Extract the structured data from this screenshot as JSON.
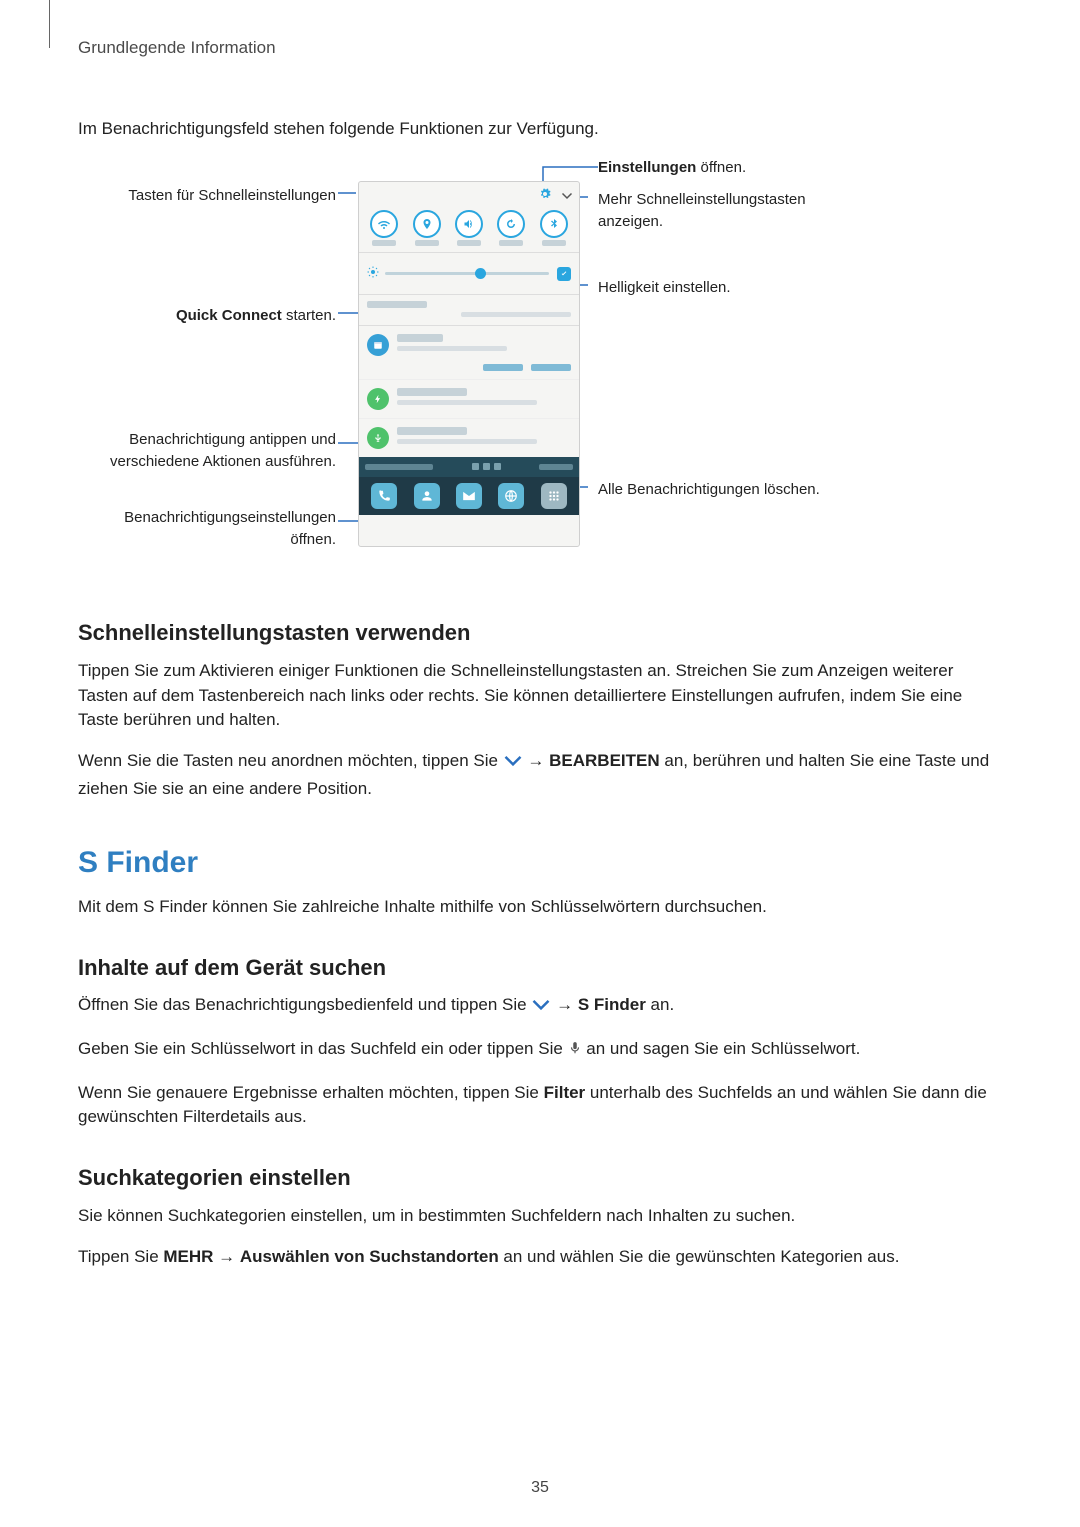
{
  "breadcrumb": "Grundlegende Information",
  "intro": "Im Benachrichtigungsfeld stehen folgende Funktionen zur Verfügung.",
  "callouts": {
    "quick_settings_buttons": "Tasten für Schnelleinstellungen",
    "open_settings_pre": "Einstellungen",
    "open_settings_post": " öffnen.",
    "more_quick": "Mehr Schnelleinstellungstasten anzeigen.",
    "brightness": "Helligkeit einstellen.",
    "quick_connect_pre": "Quick Connect",
    "quick_connect_post": " starten.",
    "tap_notification": "Benachrichtigung antippen und verschiedene Aktionen ausführen.",
    "clear_all": "Alle Benachrichtigungen löschen.",
    "notif_settings": "Benachrichtigungseinstellungen öffnen."
  },
  "section_quick_heading": "Schnelleinstellungstasten verwenden",
  "section_quick_p1": "Tippen Sie zum Aktivieren einiger Funktionen die Schnelleinstellungstasten an. Streichen Sie zum Anzeigen weiterer Tasten auf dem Tastenbereich nach links oder rechts. Sie können detailliertere Einstellungen aufrufen, indem Sie eine Taste berühren und halten.",
  "section_quick_p2_pre": "Wenn Sie die Tasten neu anordnen möchten, tippen Sie ",
  "arrow": " → ",
  "bearbeiten": "BEARBEITEN",
  "section_quick_p2_post": " an, berühren und halten Sie eine Taste und ziehen Sie sie an eine andere Position.",
  "sfinder_heading": "S Finder",
  "sfinder_intro": "Mit dem S Finder können Sie zahlreiche Inhalte mithilfe von Schlüsselwörtern durchsuchen.",
  "inhalte_heading": "Inhalte auf dem Gerät suchen",
  "inhalte_p1_pre": "Öffnen Sie das Benachrichtigungsbedienfeld und tippen Sie ",
  "sfinder_bold": "S Finder",
  "inhalte_p1_post": " an.",
  "inhalte_p2_pre": "Geben Sie ein Schlüsselwort in das Suchfeld ein oder tippen Sie ",
  "inhalte_p2_post": " an und sagen Sie ein Schlüsselwort.",
  "inhalte_p3_pre": "Wenn Sie genauere Ergebnisse erhalten möchten, tippen Sie ",
  "filter_bold": "Filter",
  "inhalte_p3_post": " unterhalb des Suchfelds an und wählen Sie dann die gewünschten Filterdetails aus.",
  "suchkat_heading": "Suchkategorien einstellen",
  "suchkat_p1": "Sie können Suchkategorien einstellen, um in bestimmten Suchfeldern nach Inhalten zu suchen.",
  "suchkat_p2_pre": "Tippen Sie ",
  "mehr_bold": "MEHR",
  "auswahl_bold": "Auswählen von Suchstandorten",
  "suchkat_p2_post": " an und wählen Sie die gewünschten Kategorien aus.",
  "page_number": "35"
}
